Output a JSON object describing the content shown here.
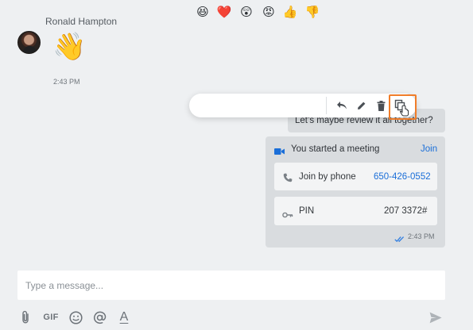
{
  "incoming": {
    "sender": "Ronald Hampton",
    "emoji": "👋",
    "time": "2:43 PM"
  },
  "reactions": {
    "emojis": [
      "😆",
      "❤️",
      "😲",
      "😡",
      "👍",
      "👎"
    ],
    "actions": [
      "reply-icon",
      "edit-icon",
      "delete-icon",
      "copy-icon"
    ]
  },
  "outgoing": {
    "text": "Let’s maybe review it all together?",
    "meeting": {
      "title": "You started a meeting",
      "join_label": "Join",
      "phone_label": "Join by phone",
      "phone_number": "650-426-0552",
      "pin_label": "PIN",
      "pin_value": "207 3372#"
    },
    "time": "2:43 PM"
  },
  "composer": {
    "placeholder": "Type a message...",
    "gif_label": "GIF",
    "format_label": "A"
  },
  "colors": {
    "accent": "#1a6ed8",
    "highlight": "#f07d2a",
    "background": "#eef0f2",
    "bubble": "#d9dcdf"
  }
}
